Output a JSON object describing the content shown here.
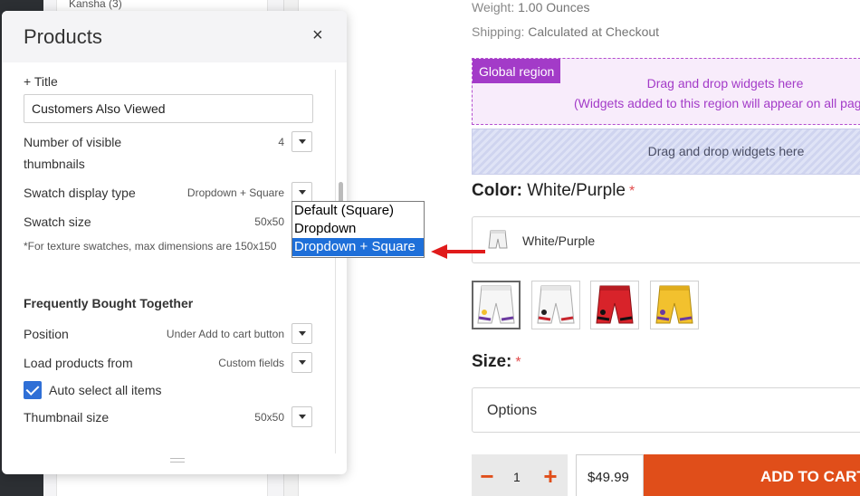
{
  "background": {
    "sidebar_item": "Kansha (3)"
  },
  "store": {
    "weight_key": "Weight:",
    "weight_value": "1.00 Ounces",
    "shipping_key": "Shipping:",
    "shipping_value": "Calculated at Checkout",
    "global_region_tag": "Global region",
    "global_drag_text": "Drag and drop widgets here",
    "global_note": "(Widgets added to this region will appear on all pag",
    "drop_zone_text": "Drag and drop widgets here",
    "color_label": "Color:",
    "color_selected": "White/Purple",
    "required_mark": "*",
    "color_select_value": "White/Purple",
    "size_label": "Size:",
    "size_select_value": "Options",
    "qty_minus": "−",
    "qty_value": "1",
    "qty_plus": "+",
    "price": "$49.99",
    "add_to_cart": "ADD TO CART",
    "swatch_colors": [
      "#ffffff",
      "#ffffff",
      "#d8232a",
      "#f2c12e"
    ]
  },
  "panel": {
    "title": "Products",
    "close_icon": "×",
    "title_toggle_label": "+ Title",
    "title_input_value": "Customers Also Viewed",
    "rows": {
      "visible_thumbs_label_1": "Number of visible",
      "visible_thumbs_label_2": "thumbnails",
      "visible_thumbs_value": "4",
      "swatch_display_label": "Swatch display type",
      "swatch_display_value": "Dropdown + Square",
      "swatch_size_label": "Swatch size",
      "swatch_size_value": "50x50",
      "texture_note": "*For texture swatches, max dimensions are 150x150",
      "fbt_section": "Frequently Bought Together",
      "position_label": "Position",
      "position_value": "Under Add to cart button",
      "load_from_label": "Load products from",
      "load_from_value": "Custom fields",
      "auto_select_label": "Auto select all items",
      "auto_select_checked": true,
      "thumb_size_label": "Thumbnail size",
      "thumb_size_value": "50x50"
    }
  },
  "dropdown": {
    "options": [
      "Default (Square)",
      "Dropdown",
      "Dropdown + Square"
    ],
    "highlighted": "Dropdown + Square"
  },
  "colors": {
    "accent_orange": "#e04e1a",
    "global_purple": "#a33bc8",
    "checkbox_blue": "#2f6fd6",
    "highlight_blue": "#1e6fd9",
    "arrow_red": "#e01b1b"
  }
}
